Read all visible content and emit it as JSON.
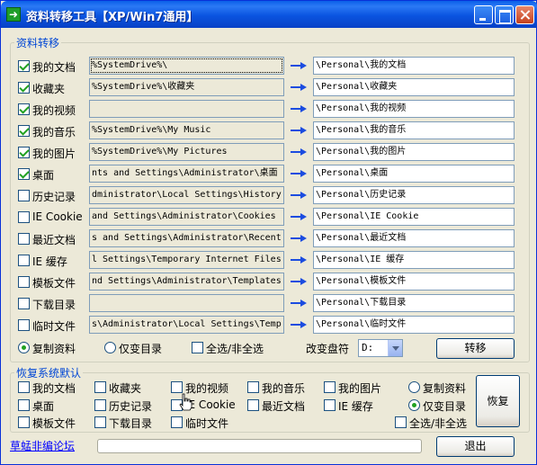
{
  "window": {
    "title": "资料转移工具【XP/Win7通用】"
  },
  "transfer": {
    "group_label": "资料转移",
    "rows": [
      {
        "label": "我的文档",
        "checked": true,
        "source": "%SystemDrive%\\",
        "target": "\\Personal\\我的文档"
      },
      {
        "label": "收藏夹",
        "checked": true,
        "source": "%SystemDrive%\\收藏夹",
        "target": "\\Personal\\收藏夹"
      },
      {
        "label": "我的视频",
        "checked": true,
        "source": "",
        "target": "\\Personal\\我的视频"
      },
      {
        "label": "我的音乐",
        "checked": true,
        "source": "%SystemDrive%\\My Music",
        "target": "\\Personal\\我的音乐"
      },
      {
        "label": "我的图片",
        "checked": true,
        "source": "%SystemDrive%\\My Pictures",
        "target": "\\Personal\\我的图片"
      },
      {
        "label": "桌面",
        "checked": true,
        "source": "nts and Settings\\Administrator\\桌面",
        "target": "\\Personal\\桌面"
      },
      {
        "label": "历史记录",
        "checked": false,
        "source": "dministrator\\Local Settings\\History",
        "target": "\\Personal\\历史记录"
      },
      {
        "label": "IE Cookie",
        "checked": false,
        "source": " and Settings\\Administrator\\Cookies",
        "target": "\\Personal\\IE Cookie"
      },
      {
        "label": "最近文档",
        "checked": false,
        "source": "s and Settings\\Administrator\\Recent",
        "target": "\\Personal\\最近文档"
      },
      {
        "label": "IE 缓存",
        "checked": false,
        "source": "l Settings\\Temporary Internet Files",
        "target": "\\Personal\\IE 缓存"
      },
      {
        "label": "模板文件",
        "checked": false,
        "source": "nd Settings\\Administrator\\Templates",
        "target": "\\Personal\\模板文件"
      },
      {
        "label": "下载目录",
        "checked": false,
        "source": "",
        "target": "\\Personal\\下载目录"
      },
      {
        "label": "临时文件",
        "checked": false,
        "source": "s\\Administrator\\Local Settings\\Temp",
        "target": "\\Personal\\临时文件"
      }
    ],
    "mode_copy": "复制资料",
    "mode_dir_only": "仅变目录",
    "select_all": "全选/非全选",
    "drive_label": "改变盘符",
    "drive_value": "D:",
    "transfer_button": "转移"
  },
  "restore": {
    "group_label": "恢复系统默认",
    "items": [
      "我的文档",
      "收藏夹",
      "我的视频",
      "我的音乐",
      "我的图片",
      "桌面",
      "历史记录",
      "IE Cookie",
      "最近文档",
      "IE 缓存",
      "模板文件",
      "下载目录",
      "临时文件"
    ],
    "mode_copy": "复制资料",
    "mode_dir_only": "仅变目录",
    "select_all": "全选/非全选",
    "restore_button": "恢复"
  },
  "footer": {
    "forum_link": "草蜢非编论坛",
    "exit_button": "退出",
    "progress": 0
  }
}
